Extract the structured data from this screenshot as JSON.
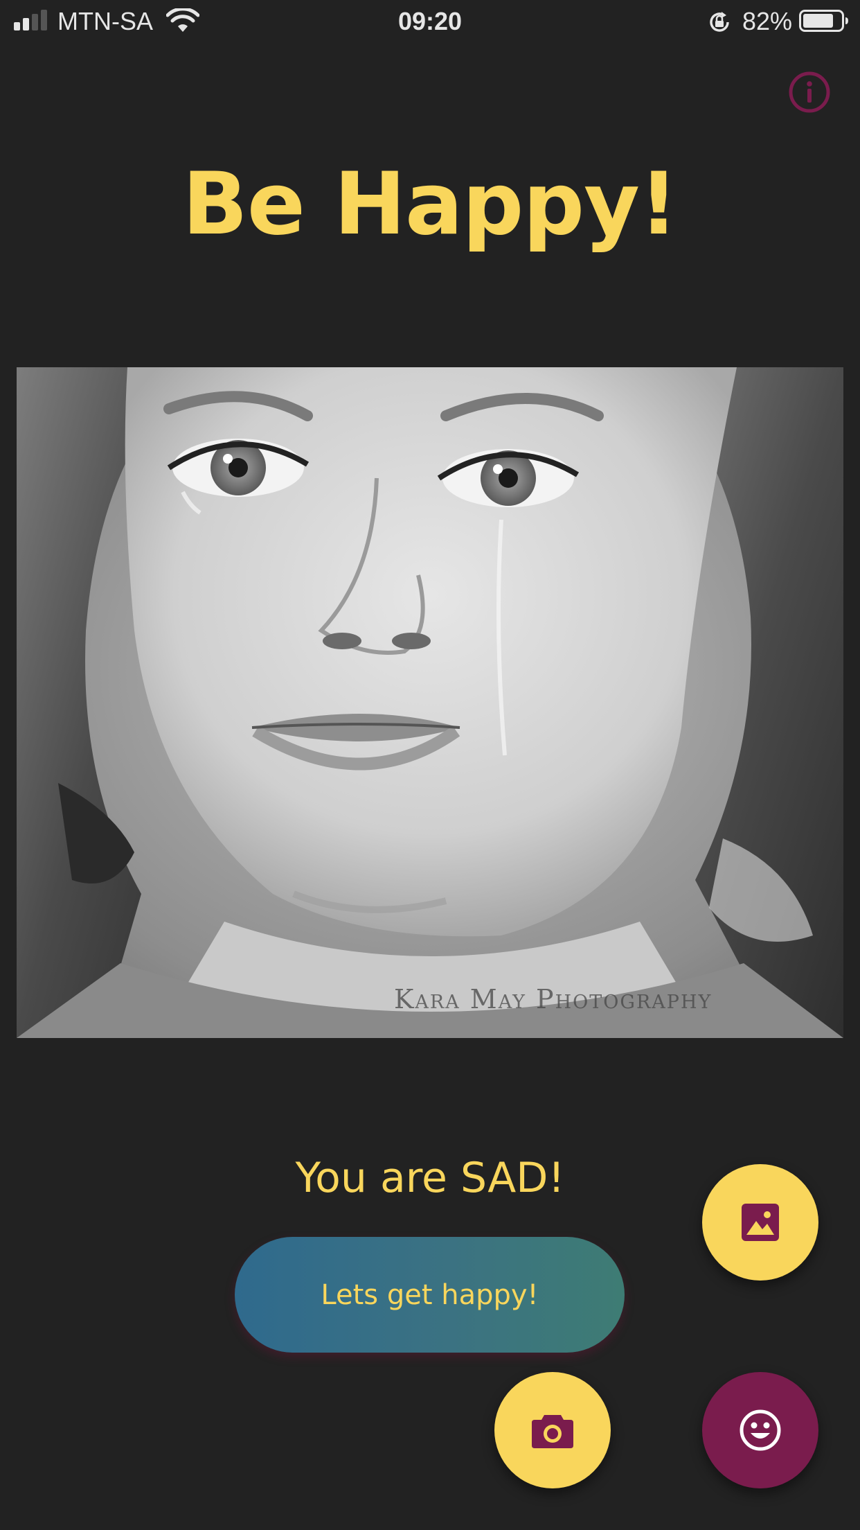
{
  "status_bar": {
    "carrier": "MTN-SA",
    "time": "09:20",
    "battery_percent": "82%",
    "battery_level": 0.82,
    "signal_bars_active": 2,
    "signal_bars_total": 4,
    "icons": [
      "signal-icon",
      "wifi-icon",
      "orientation-lock-icon",
      "battery-icon"
    ]
  },
  "header": {
    "info_icon": "info-icon"
  },
  "title": "Be Happy!",
  "photo": {
    "watermark": "Kara May Photography"
  },
  "mood": {
    "result_text": "You are SAD!",
    "cta_label": "Lets get happy!"
  },
  "fabs": {
    "gallery_icon": "image-icon",
    "camera_icon": "camera-icon",
    "emotion_icon": "smiley-icon"
  },
  "colors": {
    "background": "#222222",
    "accent_yellow": "#f9d65c",
    "accent_plum": "#7a1c4d",
    "button_gradient_start": "#2f6a8d",
    "button_gradient_end": "#3e7c74"
  }
}
